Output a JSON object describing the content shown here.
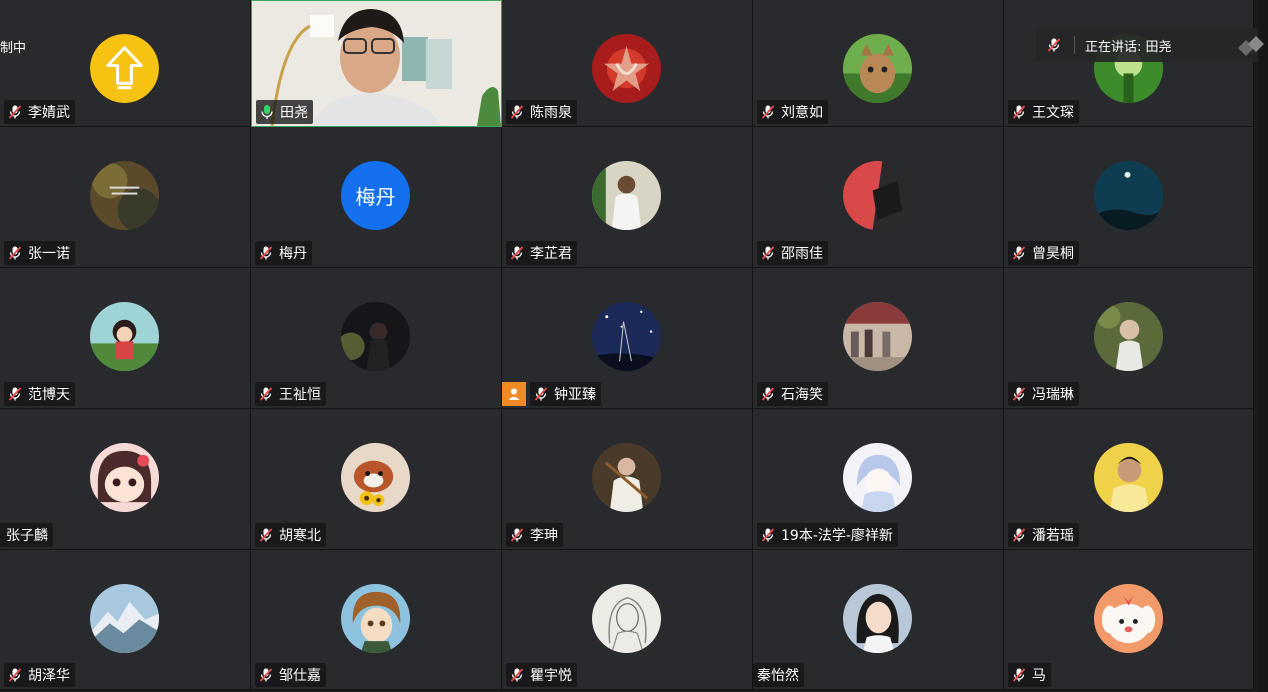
{
  "recording_text": "制中",
  "speaking_bar": {
    "text": "正在讲话: 田尧"
  },
  "tiles": [
    {
      "name": "李婧武"
    },
    {
      "name": "田尧"
    },
    {
      "name": "陈雨泉"
    },
    {
      "name": "刘意如"
    },
    {
      "name": "王文琛"
    },
    {
      "name": "张一诺"
    },
    {
      "name": "梅丹",
      "avatar_text": "梅丹"
    },
    {
      "name": "李芷君"
    },
    {
      "name": "邵雨佳"
    },
    {
      "name": "曾昊桐"
    },
    {
      "name": "范博天"
    },
    {
      "name": "王祉恒"
    },
    {
      "name": "钟亚臻"
    },
    {
      "name": "石海笑"
    },
    {
      "name": "冯瑞琳"
    },
    {
      "name": "张子麟"
    },
    {
      "name": "胡寒北"
    },
    {
      "name": "李珅"
    },
    {
      "name": "19本-法学-廖祥新"
    },
    {
      "name": "潘若瑶"
    },
    {
      "name": "胡泽华"
    },
    {
      "name": "邹仕嘉"
    },
    {
      "name": "瞿宇悦"
    },
    {
      "name": "秦怡然"
    },
    {
      "name": "马"
    }
  ],
  "colors": {
    "tile_bg": "#292a2d",
    "active_speaker_border": "#3aa55d",
    "mic_muted": "#ffffff",
    "mic_muted_slash": "#e84a4a",
    "mic_active": "#3ecf6a",
    "host_badge": "#f08a24",
    "avatar_blue": "#1570ef",
    "avatar_yellow": "#f7c312"
  },
  "icons": {
    "muted_mic": "mic-muted-icon",
    "active_mic": "mic-active-icon",
    "host": "host-user-icon",
    "upload": "upload-arrow-icon"
  }
}
